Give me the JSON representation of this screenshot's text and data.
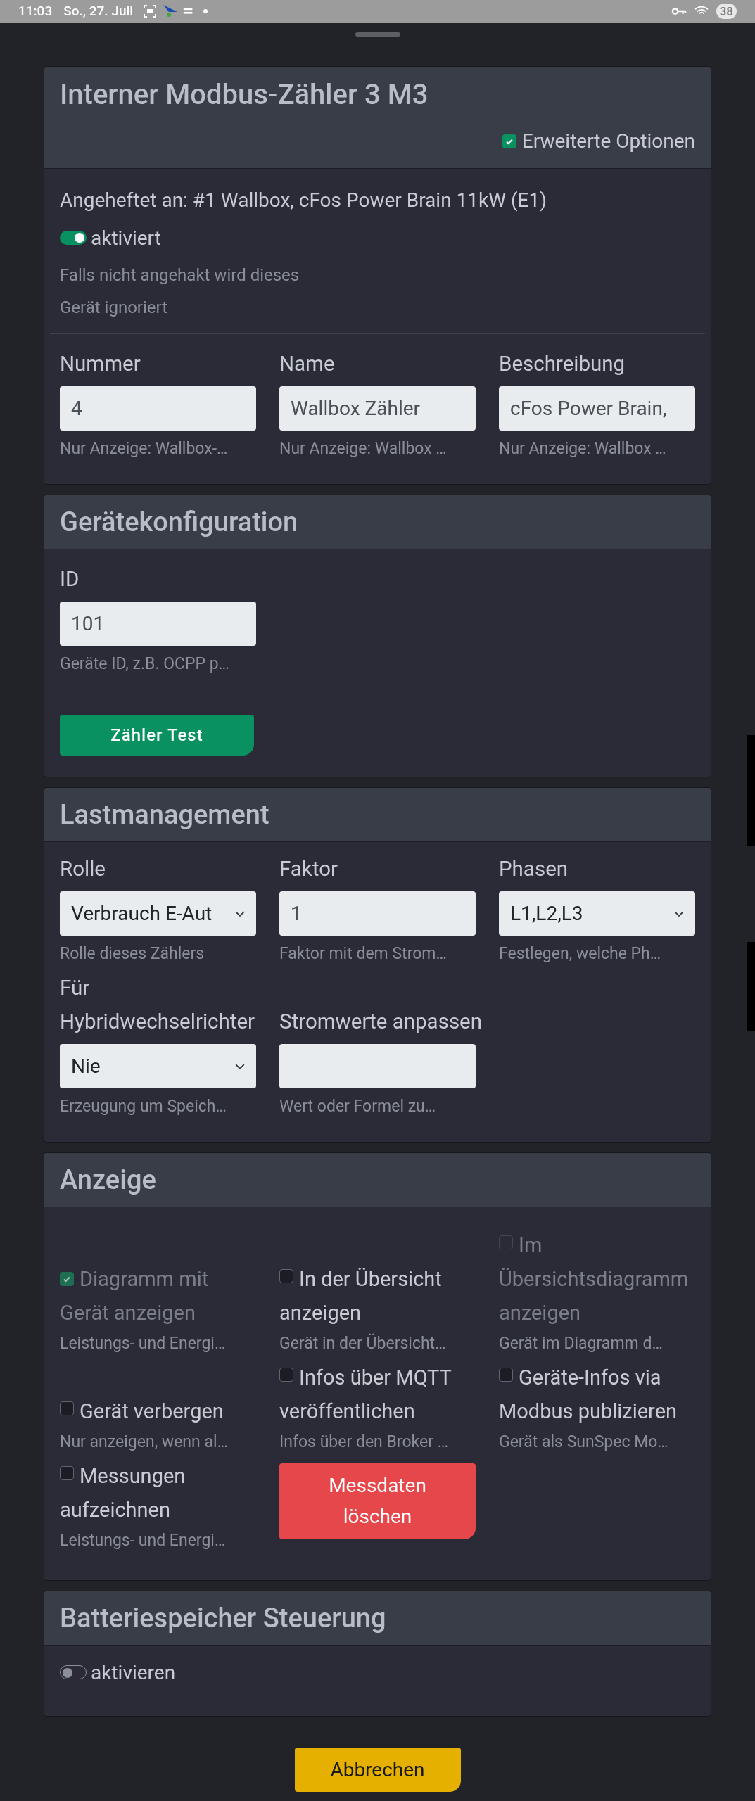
{
  "status_bar": {
    "time": "11:03",
    "date": "So., 27. Juli",
    "battery": "38"
  },
  "device_card": {
    "title": "Interner Modbus-Zähler 3 M3",
    "advanced_options": {
      "label": "Erweiterte Optionen",
      "checked": true
    },
    "attached_to": "Angeheftet an: #1 Wallbox, cFos Power Brain 11kW (E1)",
    "enabled": {
      "label": "aktiviert",
      "on": true
    },
    "enabled_hint": "Falls nicht angehakt wird dieses Gerät ignoriert",
    "fields": [
      {
        "label": "Nummer",
        "value": "4",
        "hint": "Nur Anzeige: Wallbox-…"
      },
      {
        "label": "Name",
        "value": "Wallbox Zähler",
        "hint": "Nur Anzeige: Wallbox …"
      },
      {
        "label": "Beschreibung",
        "value": "cFos Power Brain,",
        "hint": "Nur Anzeige: Wallbox …"
      }
    ]
  },
  "device_config": {
    "title": "Gerätekonfiguration",
    "fields": [
      {
        "label": "ID",
        "value": "101",
        "hint": "Geräte ID, z.B. OCPP p…"
      }
    ],
    "test_button": "Zähler Test"
  },
  "load_management": {
    "title": "Lastmanagement",
    "fields": [
      {
        "kind": "select",
        "label": "Rolle",
        "value": "Verbrauch E-Aut",
        "hint": "Rolle dieses Zählers"
      },
      {
        "kind": "input",
        "label": "Faktor",
        "value": "1",
        "hint": "Faktor mit dem Strom…"
      },
      {
        "kind": "select",
        "label": "Phasen",
        "value": "L1,L2,L3",
        "hint": "Festlegen, welche Ph…"
      },
      {
        "kind": "select",
        "label": "Für Hybridwechselrichter",
        "value": "Nie",
        "hint": "Erzeugung um Speich…"
      },
      {
        "kind": "input",
        "label": "Stromwerte anpassen",
        "hint": "Wert oder Formel zu…"
      }
    ]
  },
  "display": {
    "title": "Anzeige",
    "items": [
      {
        "kind": "checkbox",
        "label": "Diagramm mit Gerät anzeigen",
        "checked": true,
        "disabled": true,
        "hint": "Leistungs- und Energi…"
      },
      {
        "kind": "checkbox",
        "label": "In der Übersicht anzeigen",
        "checked": false,
        "disabled": false,
        "hint": "Gerät in der Übersicht…"
      },
      {
        "kind": "checkbox",
        "label": "Im Übersichtsdiagramm anzeigen",
        "checked": false,
        "disabled": true,
        "hint": "Gerät im Diagramm d…"
      },
      {
        "kind": "checkbox",
        "label": "Gerät verbergen",
        "checked": false,
        "disabled": false,
        "hint": "Nur anzeigen, wenn al…"
      },
      {
        "kind": "checkbox",
        "label": "Infos über MQTT veröffentlichen",
        "checked": false,
        "disabled": false,
        "hint": "Infos über den Broker …"
      },
      {
        "kind": "checkbox",
        "label": "Geräte-Infos via Modbus publizieren",
        "checked": false,
        "disabled": false,
        "hint": "Gerät als SunSpec Mo…"
      },
      {
        "kind": "checkbox",
        "label": "Messungen aufzeichnen",
        "checked": false,
        "disabled": false,
        "hint": "Leistungs- und Energi…"
      },
      {
        "kind": "button",
        "label": "Messdaten löschen"
      }
    ]
  },
  "battery": {
    "title": "Batteriespeicher Steuerung",
    "toggle": {
      "label": "aktivieren",
      "on": false
    }
  },
  "cancel_button": "Abbrechen"
}
